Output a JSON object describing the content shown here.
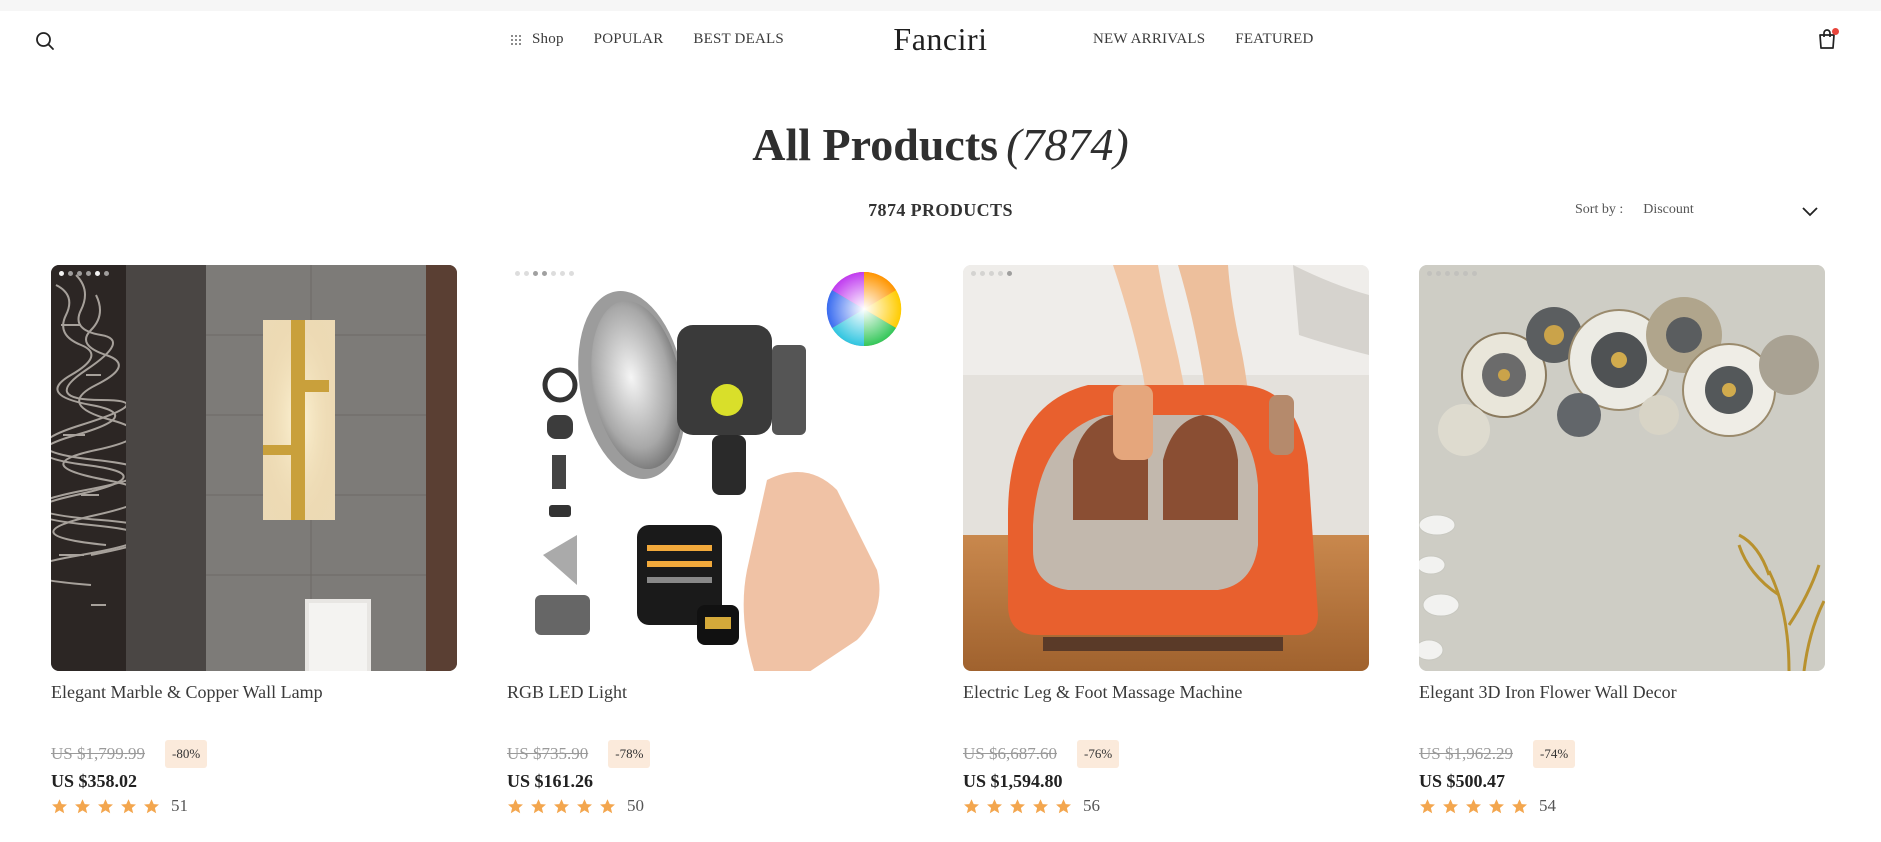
{
  "header": {
    "logo": "Fanciri",
    "nav_left": [
      {
        "label": "Shop",
        "icon": "grid-icon"
      },
      {
        "label": "POPULAR"
      },
      {
        "label": "BEST DEALS"
      }
    ],
    "nav_right": [
      {
        "label": "NEW ARRIVALS"
      },
      {
        "label": "FEATURED"
      }
    ],
    "icons": {
      "search": "search-icon",
      "cart": "shopping-bag-icon"
    },
    "cart_badge_color": "#e8453c"
  },
  "page": {
    "title": "All Products",
    "title_count": "(7874)",
    "product_count_label": "7874 PRODUCTS",
    "sort_label": "Sort by :",
    "sort_value": "Discount"
  },
  "colors": {
    "star": "#f3a64e",
    "badge_bg": "#fbeadb",
    "old_price": "#9a9a9a"
  },
  "products": [
    {
      "name": "Elegant Marble & Copper Wall Lamp",
      "old_price": "US $1,799.99",
      "discount": "-80%",
      "price": "US $358.02",
      "rating": 5,
      "reviews": "51",
      "image": "marble-copper-wall-lamp"
    },
    {
      "name": "RGB LED Light",
      "old_price": "US $735.90",
      "discount": "-78%",
      "price": "US $161.26",
      "rating": 5,
      "reviews": "50",
      "image": "rgb-led-light-kit"
    },
    {
      "name": "Electric Leg & Foot Massage Machine",
      "old_price": "US $6,687.60",
      "discount": "-76%",
      "price": "US $1,594.80",
      "rating": 5,
      "reviews": "56",
      "image": "orange-leg-foot-massager"
    },
    {
      "name": "Elegant 3D Iron Flower Wall Decor",
      "old_price": "US $1,962.29",
      "discount": "-74%",
      "price": "US $500.47",
      "rating": 5,
      "reviews": "54",
      "image": "iron-flower-wall-decor"
    }
  ]
}
